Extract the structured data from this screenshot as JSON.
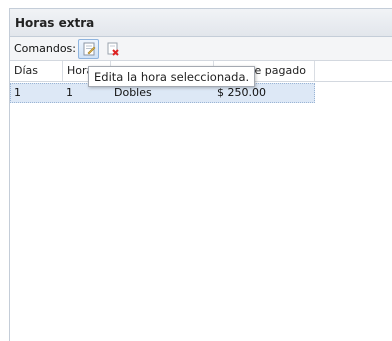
{
  "panel": {
    "title": "Horas extra"
  },
  "toolbar": {
    "label": "Comandos:",
    "edit_icon": "edit-page-icon",
    "delete_icon": "delete-page-icon"
  },
  "grid": {
    "columns": [
      "Días",
      "Horas",
      "",
      "Importe pagado"
    ],
    "rows": [
      {
        "dias": "1",
        "horas": "1",
        "tipo": "Dobles",
        "importe": "$ 250.00"
      }
    ]
  },
  "tooltip": {
    "text": "Edita la hora seleccionada."
  }
}
